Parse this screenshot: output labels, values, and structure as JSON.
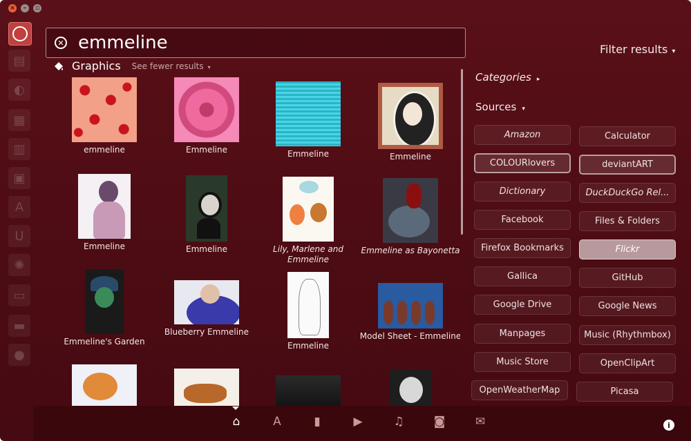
{
  "search": {
    "value": "emmeline"
  },
  "filter": {
    "label": "Filter results"
  },
  "category": {
    "title": "Graphics",
    "see_fewer": "See fewer results"
  },
  "results": [
    {
      "caption": "emmeline"
    },
    {
      "caption": "Emmeline"
    },
    {
      "caption": "Emmeline"
    },
    {
      "caption": "Emmeline"
    },
    {
      "caption": "Emmeline"
    },
    {
      "caption": "Emmeline"
    },
    {
      "caption": "Lily, Marlene and Emmeline"
    },
    {
      "caption": "Emmeline as Bayonetta"
    },
    {
      "caption": "Emmeline's Garden"
    },
    {
      "caption": "Blueberry Emmeline"
    },
    {
      "caption": "Emmeline"
    },
    {
      "caption": "Model Sheet - Emmeline"
    }
  ],
  "panel": {
    "categories_label": "Categories",
    "sources_label": "Sources",
    "sources": [
      "Amazon",
      "Calculator",
      "COLOURlovers",
      "deviantART",
      "Dictionary",
      "DuckDuckGo Rel...",
      "Facebook",
      "Files & Folders",
      "Firefox Bookmarks",
      "Flickr",
      "Gallica",
      "GitHub",
      "Google Drive",
      "Google News",
      "Manpages",
      "Music (Rhythmbox)",
      "Music Store",
      "OpenClipArt",
      "OpenWeatherMap",
      "Picasa"
    ]
  },
  "lenses": [
    "home-lens",
    "applications-lens",
    "files-lens",
    "video-lens",
    "music-lens",
    "photos-lens",
    "social-lens"
  ],
  "colors": {
    "background": "#4e0c14",
    "launcher_home": "#c04040"
  }
}
